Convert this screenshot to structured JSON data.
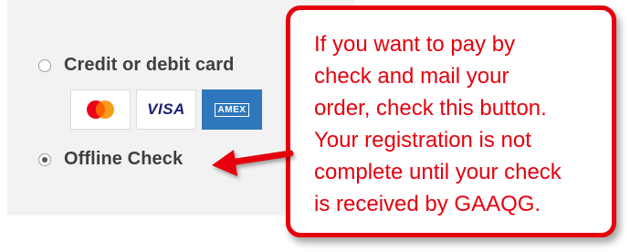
{
  "payment_options": [
    {
      "label": "Credit or debit card",
      "selected": false
    },
    {
      "label": "Offline Check",
      "selected": true
    }
  ],
  "card_logos": [
    {
      "name": "mastercard-icon"
    },
    {
      "name": "visa-icon",
      "text": "VISA"
    },
    {
      "name": "amex-icon",
      "text": "AMEX"
    }
  ],
  "callout": {
    "text": "If you want to pay by\ncheck and mail your\norder, check this button.\nYour registration is not\ncomplete until your check\nis received by GAAQG."
  },
  "colors": {
    "annotation_red": "#e5000d",
    "panel_bg": "#f2f2f2",
    "amex_blue": "#2e77bc",
    "visa_navy": "#1a1f71"
  }
}
